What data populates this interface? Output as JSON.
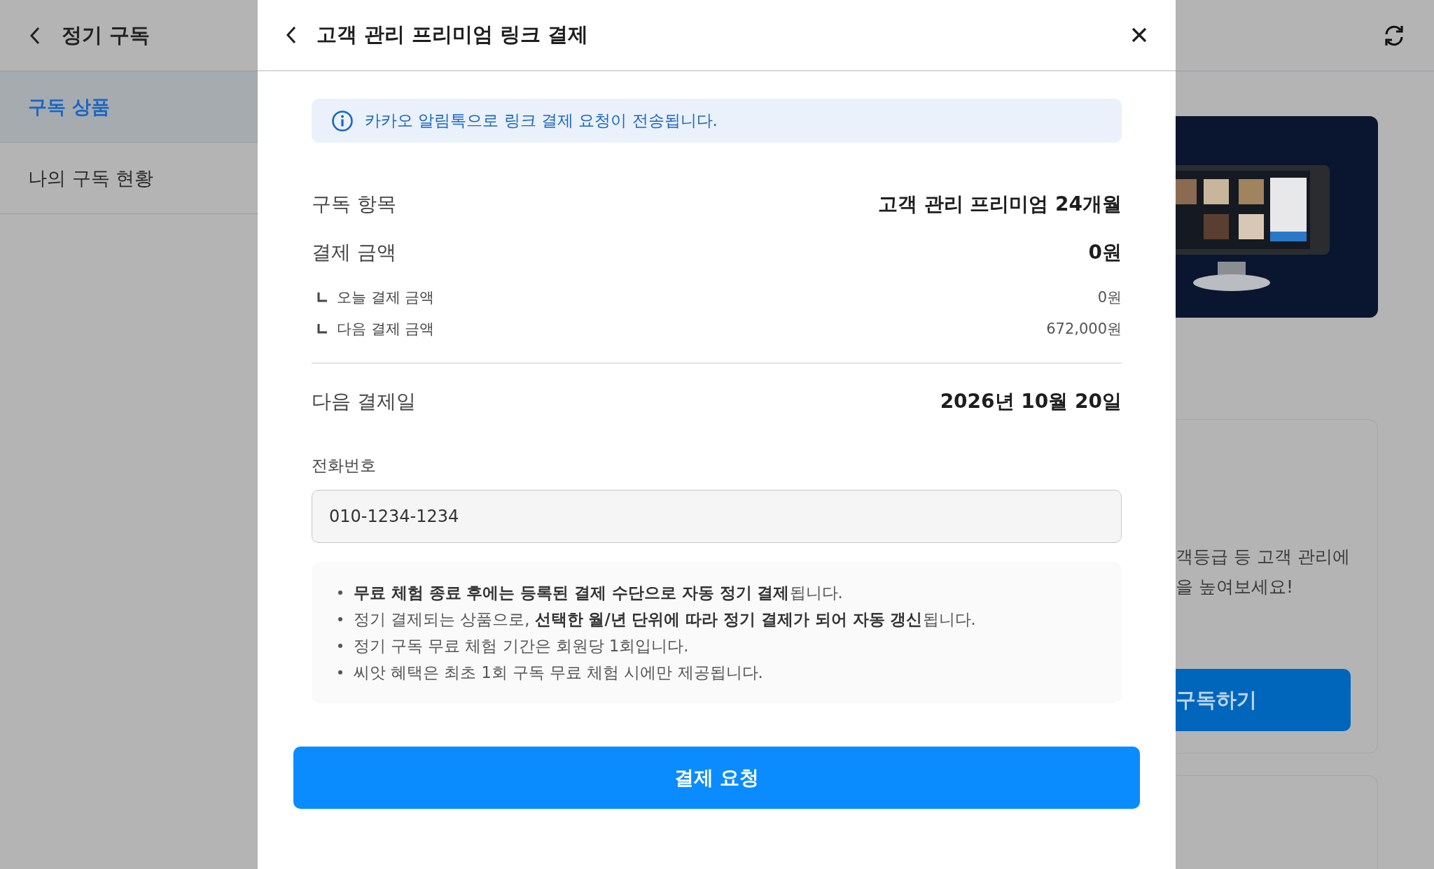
{
  "sidebar": {
    "title": "정기 구독",
    "items": [
      {
        "label": "구독 상품",
        "selected": true
      },
      {
        "label": "나의 구독 현황",
        "selected": false
      }
    ]
  },
  "modal": {
    "title": "고객 관리 프리미엄 링크 결제",
    "info": "카카오 알림톡으로 링크 결제 요청이 전송됩니다.",
    "summary": [
      {
        "label": "구독 항목",
        "value": "고객 관리 프리미엄 24개월"
      },
      {
        "label": "결제 금액",
        "value": "0원",
        "breakdown": [
          {
            "label": "오늘 결제 금액",
            "value": "0원"
          },
          {
            "label": "다음 결제 금액",
            "value": "672,000원"
          }
        ]
      }
    ],
    "next_payment": {
      "label": "다음 결제일",
      "value": "2026년 10월 20일"
    },
    "phone": {
      "label": "전화번호",
      "value": "010-1234-1234"
    },
    "notes": [
      "**무료 체험 종료 후에는 등록된 결제 수단으로 자동 정기 결제**됩니다.",
      "정기 결제되는 상품으로, **선택한 월/년 단위에 따라 정기 결제가 되어 자동 갱신**됩니다.",
      "정기 구독 무료 체험 기간은 회원당 1회입니다.",
      "씨앗 혜택은 최초 1회 구독 무료 체험 시에만 제공됩니다."
    ],
    "submit": "결제 요청"
  },
  "background": {
    "card_text": [
      "객등급 등 고객 관리에",
      "을 높여보세요!"
    ],
    "button": "구독하기"
  }
}
